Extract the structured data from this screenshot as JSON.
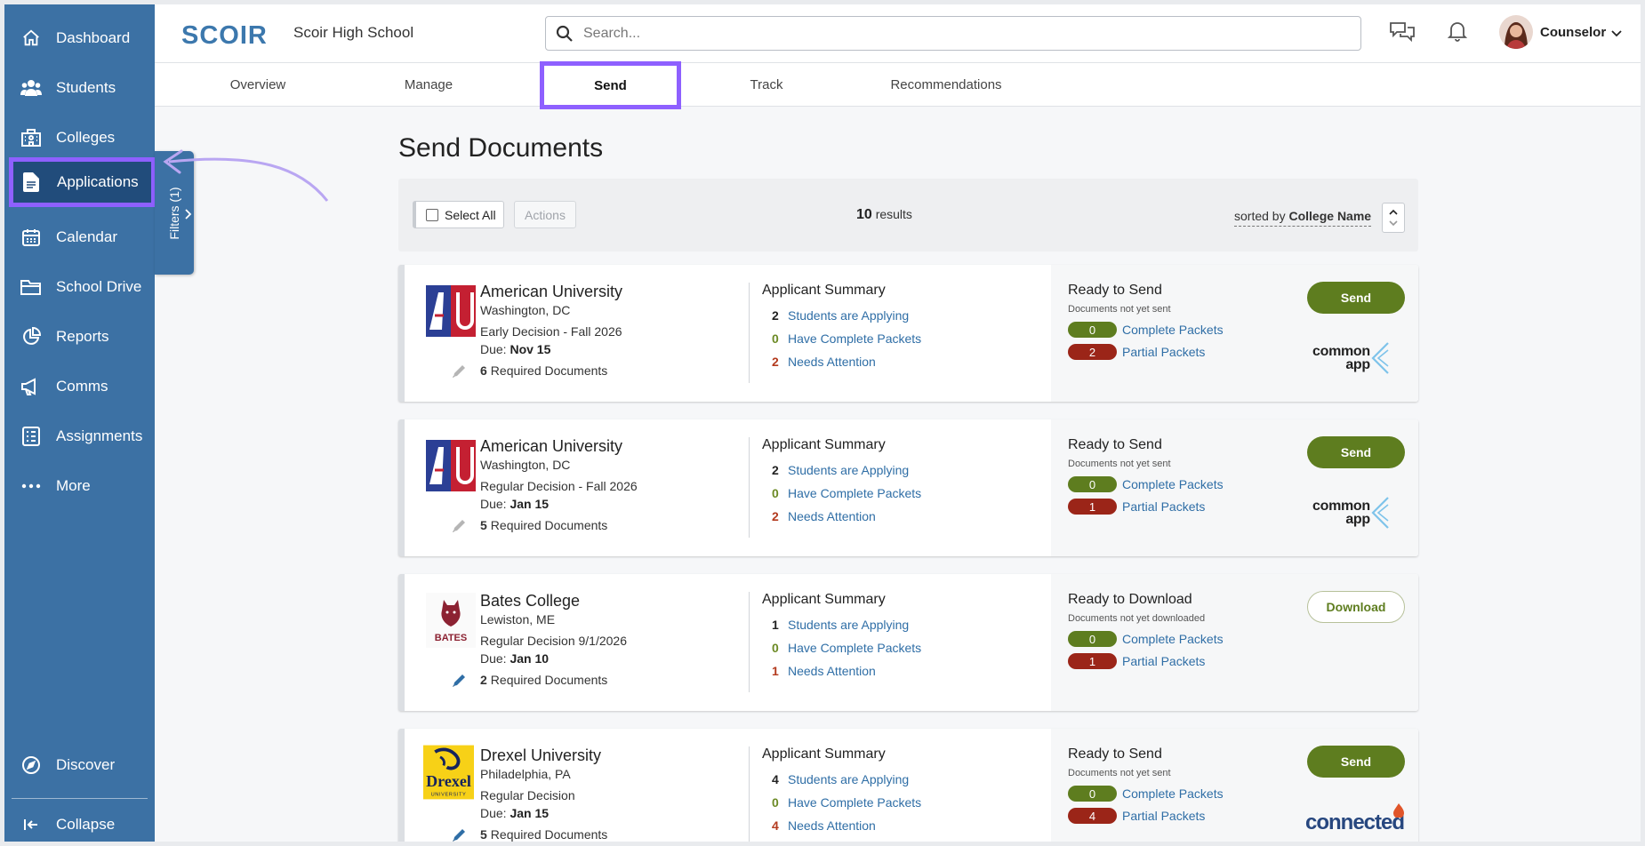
{
  "sidebar": {
    "items": [
      {
        "label": "Dashboard",
        "icon": "home-icon"
      },
      {
        "label": "Students",
        "icon": "users-icon"
      },
      {
        "label": "Colleges",
        "icon": "building-icon"
      },
      {
        "label": "Applications",
        "icon": "document-icon",
        "active": true
      },
      {
        "label": "Calendar",
        "icon": "calendar-icon"
      },
      {
        "label": "School Drive",
        "icon": "folder-icon"
      },
      {
        "label": "Reports",
        "icon": "pie-chart-icon"
      },
      {
        "label": "Comms",
        "icon": "megaphone-icon"
      },
      {
        "label": "Assignments",
        "icon": "checklist-icon"
      },
      {
        "label": "More",
        "icon": "more-icon"
      }
    ],
    "discover": "Discover",
    "collapse": "Collapse",
    "filters": "Filters (1)"
  },
  "header": {
    "logo": "SCOIR",
    "school": "Scoir High School",
    "search_placeholder": "Search...",
    "user": "Counselor"
  },
  "tabs": [
    "Overview",
    "Manage",
    "Send",
    "Track",
    "Recommendations"
  ],
  "active_tab": "Send",
  "page": {
    "title": "Send Documents",
    "select_all": "Select All",
    "actions": "Actions",
    "results_count": "10",
    "results_label": "results",
    "sorted_prefix": "sorted by",
    "sorted_field": "College Name"
  },
  "labels": {
    "summary_title": "Applicant Summary",
    "students_applying": "Students are Applying",
    "complete_packets": "Have Complete Packets",
    "needs_attention": "Needs Attention",
    "complete": "Complete Packets",
    "partial": "Partial Packets",
    "required_docs": "Required Documents",
    "due_prefix": "Due:"
  },
  "colors": {
    "sidebar": "#3c71a4",
    "sidebar_active": "#214c7b",
    "highlight": "#8e60ff",
    "send_green": "#5e7d1f",
    "partial_red": "#9b2518",
    "link_blue": "#2f6ea6"
  },
  "cards": [
    {
      "name": "American University",
      "location": "Washington, DC",
      "plan": "Early Decision - Fall 2026",
      "due": "Nov 15",
      "required": "6",
      "applying": "2",
      "complete_count": "0",
      "attention": "2",
      "ready_title": "Ready to Send",
      "ready_sub": "Documents not yet sent",
      "complete_packets": "0",
      "partial_packets": "2",
      "button": "Send",
      "platform_line1": "common",
      "platform_line2": "app",
      "logo_text": "AU"
    },
    {
      "name": "American University",
      "location": "Washington, DC",
      "plan": "Regular Decision - Fall 2026",
      "due": "Jan 15",
      "required": "5",
      "applying": "2",
      "complete_count": "0",
      "attention": "2",
      "ready_title": "Ready to Send",
      "ready_sub": "Documents not yet sent",
      "complete_packets": "0",
      "partial_packets": "1",
      "button": "Send",
      "platform_line1": "common",
      "platform_line2": "app",
      "logo_text": "AU"
    },
    {
      "name": "Bates College",
      "location": "Lewiston, ME",
      "plan": "Regular Decision 9/1/2026",
      "due": "Jan 10",
      "required": "2",
      "applying": "1",
      "complete_count": "0",
      "attention": "1",
      "ready_title": "Ready to Download",
      "ready_sub": "Documents not yet downloaded",
      "complete_packets": "0",
      "partial_packets": "1",
      "button": "Download",
      "logo_text": "BATES"
    },
    {
      "name": "Drexel University",
      "location": "Philadelphia, PA",
      "plan": "Regular Decision",
      "due": "Jan 15",
      "required": "5",
      "applying": "4",
      "complete_count": "0",
      "attention": "4",
      "ready_title": "Ready to Send",
      "ready_sub": "Documents not yet sent",
      "complete_packets": "0",
      "partial_packets": "4",
      "button": "Send",
      "platform_line1": "connected",
      "logo_text": "Drexel",
      "logo_sub": "UNIVERSITY"
    }
  ]
}
